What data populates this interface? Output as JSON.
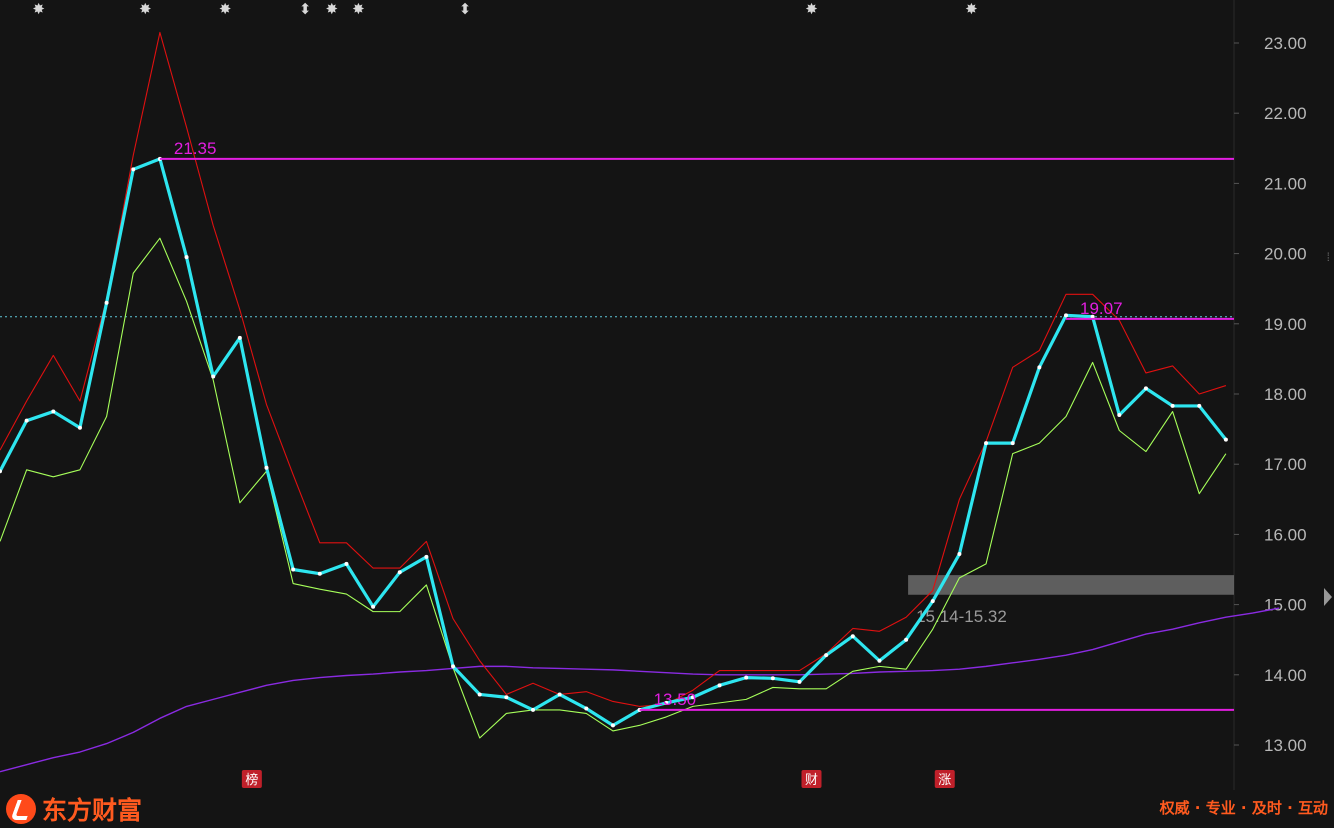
{
  "chart_data": {
    "type": "line",
    "y_axis": {
      "ticks": [
        "23.00",
        "22.00",
        "21.00",
        "20.00",
        "19.00",
        "18.00",
        "17.00",
        "16.00",
        "15.00",
        "14.00",
        "13.00"
      ],
      "ylim": [
        12.4,
        23.6
      ]
    },
    "series": [
      {
        "key": "main",
        "color": "#2ee6f0",
        "values": [
          16.9,
          17.62,
          17.75,
          17.52,
          19.3,
          21.2,
          21.35,
          19.95,
          18.25,
          18.8,
          16.95,
          15.5,
          15.44,
          15.58,
          14.97,
          15.46,
          15.68,
          14.12,
          13.72,
          13.68,
          13.5,
          13.72,
          13.52,
          13.28,
          13.5,
          13.6,
          13.68,
          13.85,
          13.96,
          13.95,
          13.9,
          14.28,
          14.55,
          14.2,
          14.5,
          15.05,
          15.72,
          17.3,
          17.3,
          18.38,
          19.12,
          19.1,
          17.7,
          18.08,
          17.83,
          17.83,
          17.35
        ]
      },
      {
        "key": "upper",
        "color": "#e01010",
        "values": [
          17.2,
          17.9,
          18.55,
          17.9,
          19.35,
          21.4,
          23.15,
          21.8,
          20.4,
          19.2,
          17.85,
          16.85,
          15.88,
          15.88,
          15.52,
          15.52,
          15.9,
          14.8,
          14.2,
          13.72,
          13.88,
          13.72,
          13.76,
          13.62,
          13.55,
          13.58,
          13.78,
          14.06,
          14.06,
          14.06,
          14.06,
          14.3,
          14.66,
          14.62,
          14.82,
          15.2,
          16.5,
          17.32,
          18.38,
          18.62,
          19.42,
          19.42,
          19.05,
          18.3,
          18.4,
          18,
          18.12
        ]
      },
      {
        "key": "lower",
        "color": "#a6ff5a",
        "values": [
          15.9,
          16.92,
          16.82,
          16.92,
          17.68,
          19.72,
          20.22,
          19.32,
          18.2,
          16.45,
          16.9,
          15.3,
          15.22,
          15.15,
          14.9,
          14.9,
          15.28,
          14.1,
          13.1,
          13.45,
          13.5,
          13.5,
          13.45,
          13.2,
          13.28,
          13.4,
          13.55,
          13.6,
          13.65,
          13.82,
          13.8,
          13.8,
          14.05,
          14.12,
          14.08,
          14.65,
          15.38,
          15.58,
          17.15,
          17.3,
          17.68,
          18.45,
          17.48,
          17.18,
          17.75,
          16.58,
          17.15
        ]
      },
      {
        "key": "ma",
        "color": "#8a2be2",
        "values": [
          12.62,
          12.72,
          12.82,
          12.9,
          13.02,
          13.18,
          13.38,
          13.55,
          13.65,
          13.75,
          13.85,
          13.92,
          13.96,
          13.99,
          14.01,
          14.04,
          14.06,
          14.09,
          14.12,
          14.12,
          14.1,
          14.09,
          14.08,
          14.07,
          14.05,
          14.03,
          14.01,
          14.0,
          14.0,
          14.0,
          14.0,
          14.01,
          14.02,
          14.04,
          14.05,
          14.06,
          14.08,
          14.12,
          14.17,
          14.22,
          14.28,
          14.36,
          14.47,
          14.58,
          14.65,
          14.74,
          14.82,
          14.88,
          14.95
        ]
      }
    ],
    "levels": [
      {
        "value": 21.35,
        "label": "21.35",
        "color": "#e21ee0",
        "style": "solid",
        "from_index": 6
      },
      {
        "value": 19.07,
        "label": "19.07",
        "color": "#e21ee0",
        "style": "solid",
        "from_index": 40
      },
      {
        "value": 13.5,
        "label": "13.50",
        "color": "#e21ee0",
        "style": "solid",
        "from_index": 24
      }
    ],
    "reference_line": {
      "value": 19.1,
      "color": "#5ec8d8",
      "style": "dotted"
    },
    "range_band": {
      "low": 15.14,
      "high": 15.32,
      "label": "15.14-15.32",
      "from_index": 34
    },
    "top_markers": [
      {
        "index": 1,
        "symbol": "✸"
      },
      {
        "index": 5,
        "symbol": "✸"
      },
      {
        "index": 8,
        "symbol": "✸"
      },
      {
        "index": 11,
        "symbol": "⬍"
      },
      {
        "index": 12,
        "symbol": "✸"
      },
      {
        "index": 13,
        "symbol": "✸"
      },
      {
        "index": 17,
        "symbol": "⬍"
      },
      {
        "index": 30,
        "symbol": "✸"
      },
      {
        "index": 36,
        "symbol": "✸"
      }
    ],
    "bottom_markers": [
      {
        "index": 9,
        "label": "榜"
      },
      {
        "index": 30,
        "label": "财"
      },
      {
        "index": 35,
        "label": "涨"
      }
    ]
  },
  "footer": {
    "brand": "东方财富",
    "slogan": "权威 · 专业 · 及时 · 互动"
  },
  "icons": {
    "brand_logo": "eastmoney-logo-icon",
    "scroll_grip": "scroll-grip-icon",
    "scroll_arrow": "scroll-right-arrow-icon"
  }
}
